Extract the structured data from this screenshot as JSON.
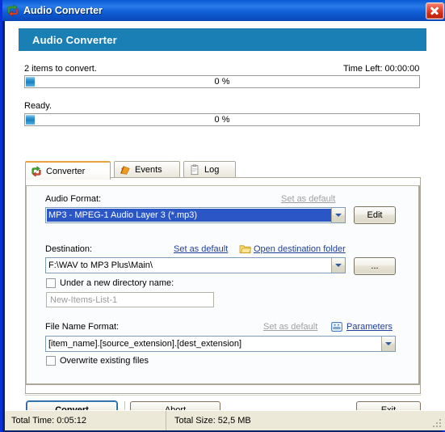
{
  "window": {
    "title": "Audio Converter",
    "app_icon": "audio-convert-arrows-icon",
    "close_label": "Close"
  },
  "banner": {
    "title": "Audio Converter"
  },
  "progress": {
    "items_label": "2 items to convert.",
    "time_left_label": "Time Left: 00:00:00",
    "overall_percent": "0 %",
    "status_label": "Ready.",
    "current_percent": "0 %"
  },
  "tabs": [
    {
      "label": "Converter",
      "icon": "converter-arrows-icon",
      "active": true
    },
    {
      "label": "Events",
      "icon": "events-flag-icon",
      "active": false
    },
    {
      "label": "Log",
      "icon": "log-clipboard-icon",
      "active": false
    }
  ],
  "converter": {
    "audio_format": {
      "label": "Audio Format:",
      "set_as_default": "Set as default",
      "value": "MP3 - MPEG-1 Audio Layer 3 (*.mp3)",
      "edit_button": "Edit"
    },
    "destination": {
      "label": "Destination:",
      "set_as_default": "Set as default",
      "open_folder_link": "Open destination folder",
      "folder_icon": "folder-icon",
      "value": "F:\\WAV to MP3 Plus\\Main\\",
      "browse_button": "..."
    },
    "new_directory": {
      "checkbox_label": "Under a new directory name:",
      "checked": false,
      "value": "New-Items-List-1"
    },
    "file_name_format": {
      "label": "File Name Format:",
      "set_as_default": "Set as default",
      "parameters_link": "Parameters",
      "parameters_icon": "parameters-icon",
      "value": "[item_name].[source_extension].[dest_extension]"
    },
    "overwrite": {
      "checkbox_label": "Overwrite existing files",
      "checked": false
    }
  },
  "actions": {
    "convert": "Convert",
    "abort": "Abort",
    "exit": "Exit"
  },
  "statusbar": {
    "total_time": "Total Time: 0:05:12",
    "total_size": "Total Size: 52,5 MB"
  },
  "colors": {
    "title_bar": "#0c59d4",
    "banner": "#1a7fb5",
    "selection": "#2a56c6",
    "link": "#20409a",
    "tab_accent": "#e8a33d",
    "status_bg": "#ece9d8"
  }
}
